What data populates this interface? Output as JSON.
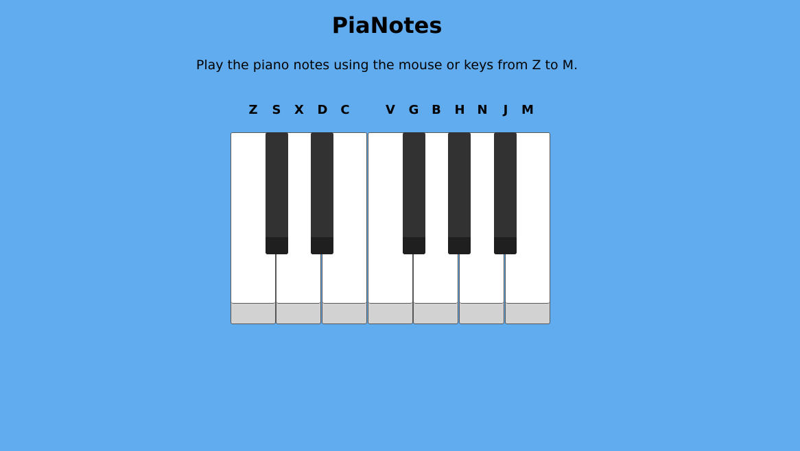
{
  "app": {
    "title": "PiaNotes",
    "instructions": "Play the piano notes using the mouse or keys from Z to M."
  },
  "key_hints": [
    "Z",
    "S",
    "X",
    "D",
    "C",
    "V",
    "G",
    "B",
    "H",
    "N",
    "J",
    "M"
  ],
  "piano": {
    "white_keys": [
      "Z",
      "X",
      "C",
      "V",
      "B",
      "N",
      "M"
    ],
    "black_keys": [
      "S",
      "D",
      "G",
      "H",
      "J"
    ]
  },
  "colors": {
    "background": "#61acef",
    "white_key": "#ffffff",
    "white_key_base": "#d2d2d2",
    "black_key": "#323232",
    "black_key_base": "#1f1f1f"
  }
}
